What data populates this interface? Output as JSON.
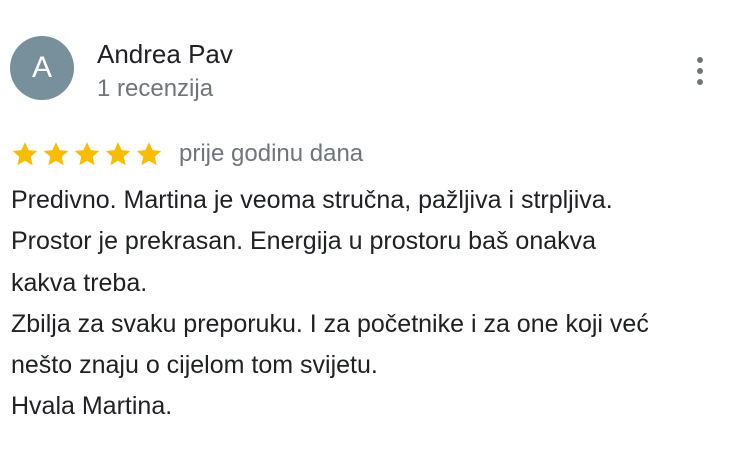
{
  "author": {
    "initial": "A",
    "name": "Andrea Pav",
    "review_count": "1 recenzija",
    "avatar_color": "#78909c"
  },
  "review": {
    "rating": 5,
    "max_rating": 5,
    "star_color": "#fbbc04",
    "date": "prije godinu dana",
    "lines": [
      "Predivno. Martina je veoma stručna, pažljiva i strpljiva.",
      "Prostor je prekrasan. Energija u prostoru baš onakva",
      "kakva treba.",
      "Zbilja za svaku preporuku. I za početnike i za one koji već",
      "nešto znaju o cijelom tom svijetu.",
      "Hvala Martina."
    ]
  },
  "menu": {
    "icon": "more-vert-icon"
  }
}
